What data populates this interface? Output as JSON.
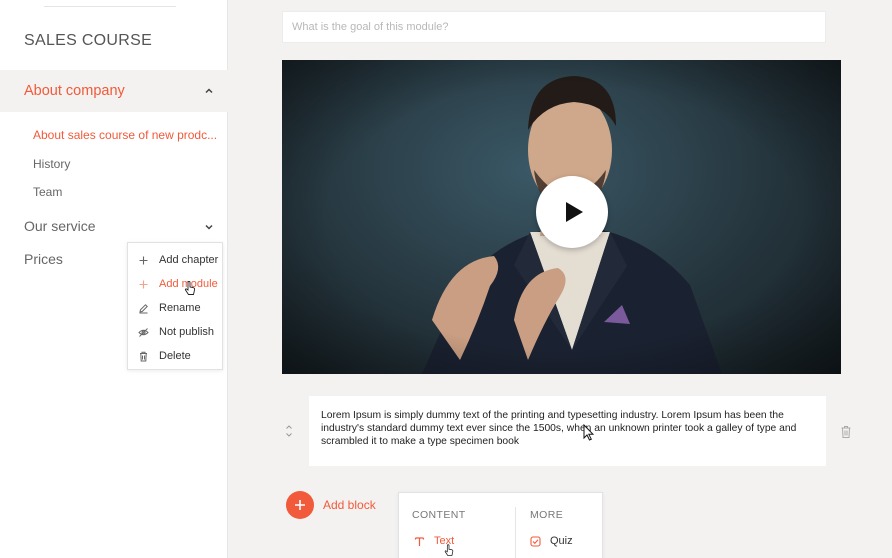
{
  "sidebar": {
    "course_title": "SALES COURSE",
    "active_section": "About company",
    "sub_items": [
      "About sales course of new prodc...",
      "History",
      "Team"
    ],
    "sections": [
      "Our service",
      "Prices"
    ]
  },
  "context_menu": {
    "items": [
      {
        "label": "Add chapter",
        "icon": "plus-icon"
      },
      {
        "label": "Add module",
        "icon": "plus-icon"
      },
      {
        "label": "Rename",
        "icon": "pencil-icon"
      },
      {
        "label": "Not publish",
        "icon": "eye-off-icon"
      },
      {
        "label": "Delete",
        "icon": "trash-icon"
      }
    ]
  },
  "main": {
    "goal_placeholder": "What is the goal of this module?",
    "text_block": "Lorem Ipsum is simply dummy text of the printing and typesetting industry. Lorem Ipsum has been the industry's standard dummy text ever since the 1500s, when an unknown printer took a galley of type and scrambled it to make a type specimen book",
    "add_block_label": "Add block"
  },
  "block_panel": {
    "content_header": "CONTENT",
    "more_header": "MORE",
    "content_items": [
      {
        "label": "Text",
        "icon": "text-icon"
      }
    ],
    "more_items": [
      {
        "label": "Quiz",
        "icon": "quiz-check-icon"
      }
    ]
  },
  "colors": {
    "accent": "#f15a3a",
    "sidebar_bg": "#ffffff",
    "page_bg": "#f3f2f1"
  }
}
